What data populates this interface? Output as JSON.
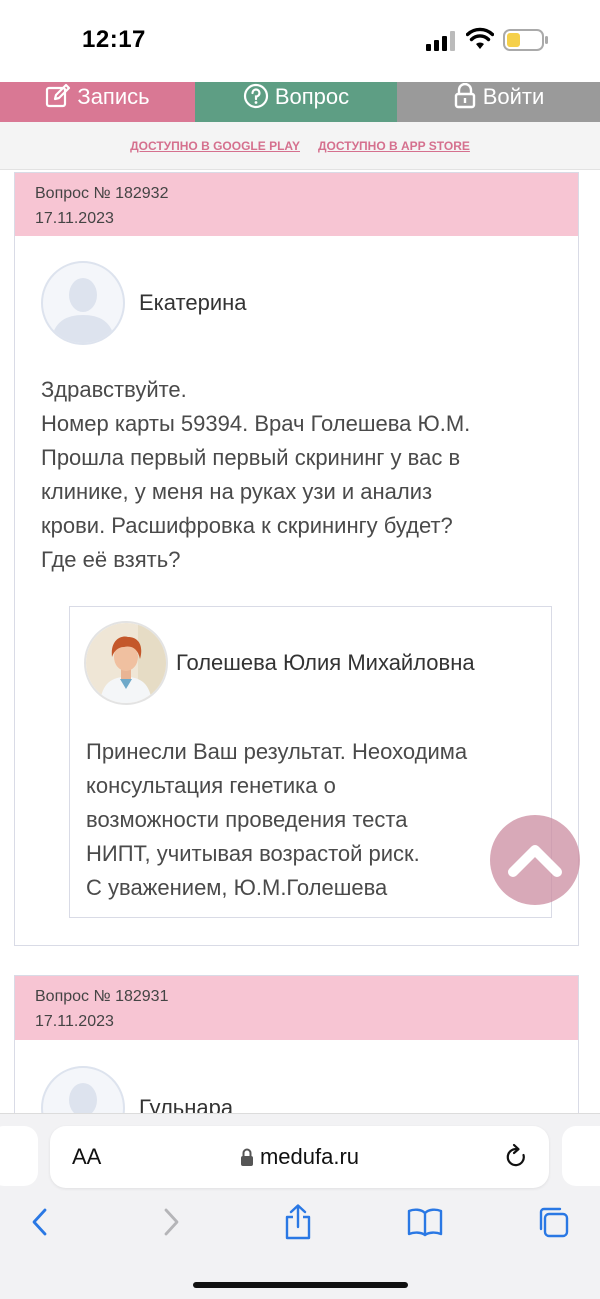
{
  "status_bar": {
    "time": "12:17"
  },
  "nav": {
    "record_label": "Запись",
    "question_label": "Вопрос",
    "login_label": "Войти",
    "icons": [
      "edit-icon",
      "question-circle-icon",
      "lock-icon"
    ]
  },
  "stores": {
    "google_play": "ДОСТУПНО В GOOGLE PLAY",
    "app_store": "ДОСТУПНО В APP STORE"
  },
  "questions": [
    {
      "number": "Вопрос № 182932",
      "date": "17.11.2023",
      "author": "Екатерина",
      "text_lines": [
        "Здравствуйте.",
        "Номер карты 59394. Врач Голешева Ю.М.",
        "Прошла первый первый скрининг у вас в",
        "клинике, у меня на руках узи и анализ",
        "крови. Расшифровка к скринингу будет?",
        "Где её взять?"
      ],
      "answer": {
        "doctor": "Голешева Юлия Михайловна",
        "text_lines": [
          "Принесли Ваш результат. Неоходима",
          "консультация генетика о",
          "возможности проведения теста",
          "НИПТ, учитывая возрастой риск.",
          "С уважением, Ю.М.Голешева"
        ]
      }
    },
    {
      "number": "Вопрос № 182931",
      "date": "17.11.2023",
      "author": "Гульнара"
    }
  ],
  "browser": {
    "text_size_label": "AA",
    "url": "medufa.ru"
  },
  "colors": {
    "record": "#d97894",
    "question": "#5e9e84",
    "login": "#9a9a9a",
    "card_header": "#f7c5d3",
    "store_link": "#d5708e"
  }
}
